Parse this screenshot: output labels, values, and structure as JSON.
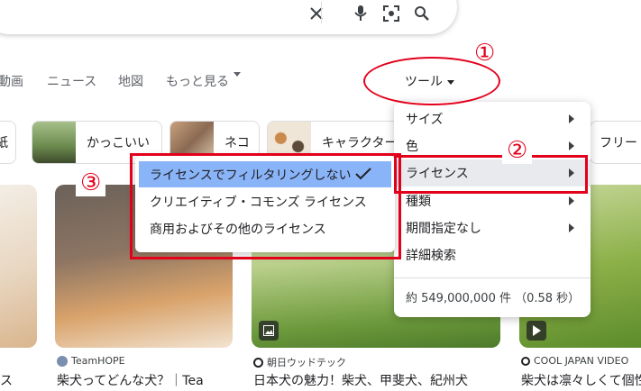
{
  "nav": {
    "tabs": [
      "動画",
      "ニュース",
      "地図",
      "もっと見る"
    ],
    "tools_label": "ツール"
  },
  "chips": [
    {
      "label": "紙",
      "thumb": "#eeeeee"
    },
    {
      "label": "かっこいい",
      "thumb": "#6b8a4e"
    },
    {
      "label": "ネコ",
      "thumb": "#8a6a52"
    },
    {
      "label": "キャラクター",
      "thumb": "#f0e6d8"
    },
    {
      "label": "フリー",
      "thumb": "#ffffff"
    }
  ],
  "results": [
    {
      "source": "",
      "title": "ス"
    },
    {
      "source": "TeamHOPE",
      "title": "柴犬ってどんな犬？｜Tea"
    },
    {
      "source": "朝日ウッドテック",
      "title": "日本犬の魅力！柴犬、甲斐犬、紀州犬"
    },
    {
      "source": "COOL JAPAN VIDEO",
      "title": "柴犬は凛々しくて個性"
    }
  ],
  "tools_menu": {
    "items": [
      {
        "label": "サイズ",
        "has_submenu": true
      },
      {
        "label": "色",
        "has_submenu": true
      },
      {
        "label": "ライセンス",
        "has_submenu": true,
        "selected": true
      },
      {
        "label": "種類",
        "has_submenu": true
      },
      {
        "label": "期間指定なし",
        "has_submenu": true
      },
      {
        "label": "詳細検索",
        "has_submenu": false
      }
    ],
    "result_count": "約 549,000,000 件 （0.58 秒）"
  },
  "license_submenu": {
    "items": [
      {
        "label": "ライセンスでフィルタリングしない",
        "selected": true
      },
      {
        "label": "クリエイティブ・コモンズ ライセンス",
        "selected": false
      },
      {
        "label": "商用およびその他のライセンス",
        "selected": false
      }
    ]
  },
  "annotations": {
    "one": "①",
    "two": "②",
    "three": "③",
    "color": "#e3001b"
  },
  "colors": {
    "highlight": "#8ab4f8",
    "selected_row": "#e8eaed"
  }
}
